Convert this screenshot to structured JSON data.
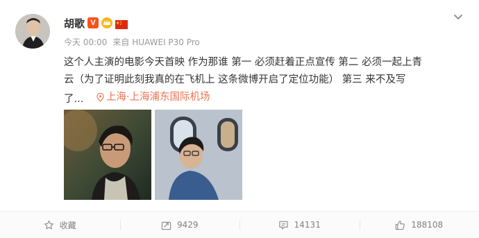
{
  "user": {
    "name": "胡歌",
    "verified_label": "V"
  },
  "meta": {
    "time": "今天 00:00",
    "source": "来自 HUAWEI P30 Pro"
  },
  "post": {
    "lines": [
      "这个人主演的电影今天首映 作为那谁 第一 必须赶着正点宣传 第二 必须一起上青",
      "云（为了证明此刻我真的在飞机上 这条微博开启了定位功能） 第三 来不及写",
      "了..."
    ],
    "location": "上海·上海浦东国际机场"
  },
  "actions": {
    "favorite": "收藏",
    "repost": "9429",
    "comment": "14131",
    "like": "188108"
  },
  "colors": {
    "location": "#eb7350",
    "verified": "#f7541b",
    "muted": "#999999"
  }
}
